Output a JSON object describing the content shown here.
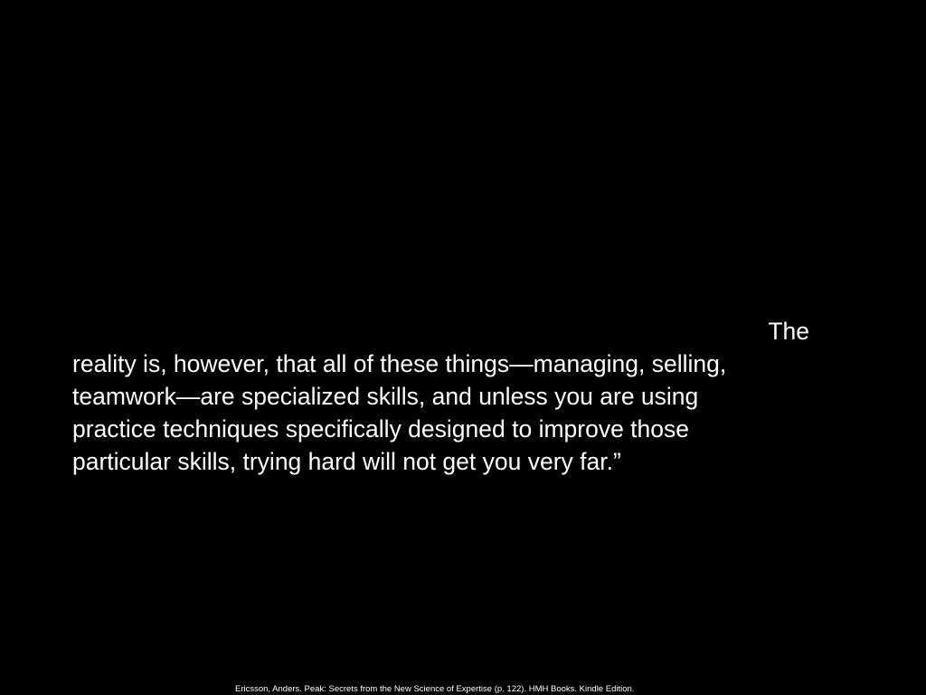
{
  "slide": {
    "background": "#000000",
    "text_color": "#ffffff",
    "quote_lines": [
      "The",
      "reality is, however, that all of these things—managing, selling,",
      "teamwork—are specialized skills, and unless you are using",
      "practice techniques specifically designed to improve those",
      "particular skills, trying hard will not get you very far.”"
    ],
    "citation": "Ericsson, Anders. Peak: Secrets from the New Science of Expertise (p. 122). HMH Books. Kindle Edition."
  }
}
